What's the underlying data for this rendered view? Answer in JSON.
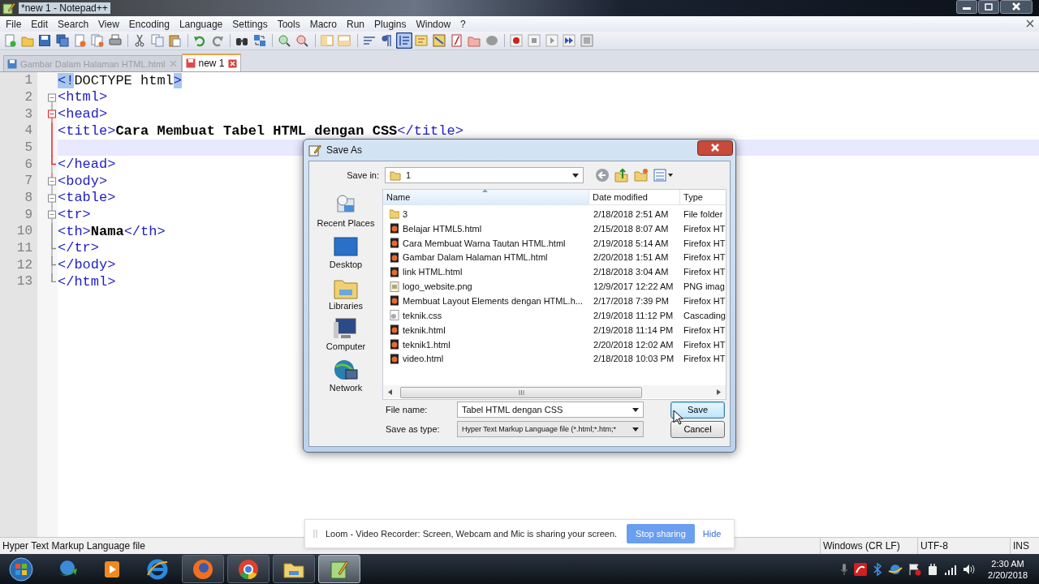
{
  "window": {
    "title": "*new 1 - Notepad++"
  },
  "menu": [
    "File",
    "Edit",
    "Search",
    "View",
    "Encoding",
    "Language",
    "Settings",
    "Tools",
    "Macro",
    "Run",
    "Plugins",
    "Window",
    "?"
  ],
  "toolbar": [
    {
      "kind": "new",
      "pressed": false
    },
    {
      "kind": "open",
      "pressed": false
    },
    {
      "kind": "save",
      "pressed": false
    },
    {
      "kind": "save-all",
      "pressed": false
    },
    {
      "kind": "close",
      "pressed": false
    },
    {
      "kind": "close-all",
      "pressed": false
    },
    {
      "kind": "print",
      "pressed": false
    },
    {
      "kind": "sep"
    },
    {
      "kind": "cut",
      "pressed": false
    },
    {
      "kind": "copy",
      "pressed": false
    },
    {
      "kind": "paste",
      "pressed": false
    },
    {
      "kind": "sep"
    },
    {
      "kind": "undo",
      "pressed": false
    },
    {
      "kind": "redo",
      "pressed": false
    },
    {
      "kind": "sep"
    },
    {
      "kind": "find",
      "pressed": false
    },
    {
      "kind": "replace",
      "pressed": false
    },
    {
      "kind": "sep"
    },
    {
      "kind": "zoom-in",
      "pressed": false
    },
    {
      "kind": "zoom-out",
      "pressed": false
    },
    {
      "kind": "sep"
    },
    {
      "kind": "sync-v",
      "pressed": false
    },
    {
      "kind": "sync-h",
      "pressed": false
    },
    {
      "kind": "sep"
    },
    {
      "kind": "wrap",
      "pressed": false
    },
    {
      "kind": "all-chars",
      "pressed": false
    },
    {
      "kind": "indent",
      "pressed": true
    },
    {
      "kind": "udl",
      "pressed": false
    },
    {
      "kind": "doc-map",
      "pressed": false
    },
    {
      "kind": "function-list",
      "pressed": false
    },
    {
      "kind": "folder-ws",
      "pressed": false
    },
    {
      "kind": "monitor",
      "pressed": false
    },
    {
      "kind": "sep"
    },
    {
      "kind": "record",
      "pressed": false
    },
    {
      "kind": "stop",
      "pressed": false
    },
    {
      "kind": "play",
      "pressed": false
    },
    {
      "kind": "play-multi",
      "pressed": false
    },
    {
      "kind": "save-macro",
      "pressed": false
    }
  ],
  "tabs": [
    {
      "label": "Gambar Dalam Halaman HTML.html",
      "selected": false,
      "modified": false
    },
    {
      "label": "new 1",
      "selected": true,
      "modified": true
    }
  ],
  "editor": {
    "lines": [
      {
        "number": "1",
        "kind": "none",
        "in_current_block": false,
        "current": false,
        "tokens": [
          {
            "kind": "match",
            "text": "<!"
          },
          {
            "kind": "plain",
            "text": "DOCTYPE html"
          },
          {
            "kind": "match",
            "text": ">"
          }
        ]
      },
      {
        "number": "2",
        "kind": "open",
        "in_current_block": false,
        "current": false,
        "tokens": [
          {
            "kind": "tag",
            "text": "<html>"
          }
        ]
      },
      {
        "number": "3",
        "kind": "open",
        "in_current_block": true,
        "current": false,
        "tokens": [
          {
            "kind": "tag",
            "text": "<head>"
          }
        ]
      },
      {
        "number": "4",
        "kind": "line",
        "in_current_block": true,
        "current": false,
        "tokens": [
          {
            "kind": "tag",
            "text": "<title>"
          },
          {
            "kind": "text",
            "text": "Cara Membuat Tabel HTML dengan CSS"
          },
          {
            "kind": "tag",
            "text": "</title>"
          }
        ]
      },
      {
        "number": "5",
        "kind": "line",
        "in_current_block": true,
        "current": true
      },
      {
        "number": "6",
        "kind": "end",
        "in_current_block": true,
        "current": false,
        "tokens": [
          {
            "kind": "tag",
            "text": "</head>"
          }
        ]
      },
      {
        "number": "7",
        "kind": "open",
        "in_current_block": false,
        "current": false,
        "tokens": [
          {
            "kind": "tag",
            "text": "<body>"
          }
        ]
      },
      {
        "number": "8",
        "kind": "open",
        "in_current_block": false,
        "current": false,
        "tokens": [
          {
            "kind": "tag",
            "text": "<table>"
          }
        ]
      },
      {
        "number": "9",
        "kind": "open",
        "in_current_block": false,
        "current": false,
        "tokens": [
          {
            "kind": "tag",
            "text": "<tr>"
          }
        ]
      },
      {
        "number": "10",
        "kind": "line",
        "in_current_block": false,
        "current": false,
        "tokens": [
          {
            "kind": "tag",
            "text": "<th>"
          },
          {
            "kind": "text",
            "text": "Nama"
          },
          {
            "kind": "tag",
            "text": "</th>"
          }
        ]
      },
      {
        "number": "11",
        "kind": "end",
        "in_current_block": false,
        "current": false,
        "tokens": [
          {
            "kind": "tag",
            "text": "</tr>"
          }
        ]
      },
      {
        "number": "12",
        "kind": "end",
        "in_current_block": false,
        "current": false,
        "tokens": [
          {
            "kind": "tag",
            "text": "</body>"
          }
        ]
      },
      {
        "number": "13",
        "kind": "end",
        "in_current_block": false,
        "current": false,
        "tokens": [
          {
            "kind": "tag",
            "text": "</html>"
          }
        ]
      }
    ]
  },
  "dialog": {
    "title": "Save As",
    "save_in_label": "Save in:",
    "save_in": "1",
    "places": [
      {
        "kind": "recent",
        "label": "Recent Places"
      },
      {
        "kind": "desktop",
        "label": "Desktop"
      },
      {
        "kind": "libraries",
        "label": "Libraries"
      },
      {
        "kind": "computer",
        "label": "Computer"
      },
      {
        "kind": "network",
        "label": "Network"
      }
    ],
    "columns": [
      {
        "label": "Name",
        "sorted": true
      },
      {
        "label": "Date modified",
        "sorted": false
      },
      {
        "label": "Type",
        "sorted": false
      }
    ],
    "files": [
      {
        "kind": "folder",
        "name": "3",
        "date": "2/18/2018 2:51 AM",
        "type": "File folder"
      },
      {
        "kind": "html",
        "name": "Belajar HTML5.html",
        "date": "2/15/2018 8:07 AM",
        "type": "Firefox HT"
      },
      {
        "kind": "html",
        "name": "Cara Membuat Warna Tautan HTML.html",
        "date": "2/19/2018 5:14 AM",
        "type": "Firefox HT"
      },
      {
        "kind": "html",
        "name": "Gambar Dalam Halaman HTML.html",
        "date": "2/20/2018 1:51 AM",
        "type": "Firefox HT"
      },
      {
        "kind": "html",
        "name": "link HTML.html",
        "date": "2/18/2018 3:04 AM",
        "type": "Firefox HT"
      },
      {
        "kind": "image",
        "name": "logo_website.png",
        "date": "12/9/2017 12:22 AM",
        "type": "PNG imag"
      },
      {
        "kind": "html",
        "name": "Membuat Layout Elements dengan HTML.h...",
        "date": "2/17/2018 7:39 PM",
        "type": "Firefox HT"
      },
      {
        "kind": "css",
        "name": "teknik.css",
        "date": "2/19/2018 11:12 PM",
        "type": "Cascading"
      },
      {
        "kind": "html",
        "name": "teknik.html",
        "date": "2/19/2018 11:14 PM",
        "type": "Firefox HT"
      },
      {
        "kind": "html",
        "name": "teknik1.html",
        "date": "2/20/2018 12:02 AM",
        "type": "Firefox HT"
      },
      {
        "kind": "html",
        "name": "video.html",
        "date": "2/18/2018 10:03 PM",
        "type": "Firefox HT"
      }
    ],
    "file_name_label": "File name:",
    "file_name": "Tabel HTML dengan CSS",
    "type_label": "Save as type:",
    "save_type": "Hyper Text Markup Language file (*.html;*.htm;*",
    "buttons": [
      {
        "label": "Save",
        "default": true
      },
      {
        "label": "Cancel",
        "default": false
      }
    ]
  },
  "status_bar": {
    "file_type": "Hyper Text Markup Language file",
    "eol": "Windows (CR LF)",
    "encoding": "UTF-8",
    "mode": "INS"
  },
  "loom_bar": {
    "message": "Loom - Video Recorder: Screen, Webcam and Mic is sharing your screen.",
    "stop": "Stop sharing",
    "hide": "Hide"
  },
  "taskbar": {
    "items": [
      {
        "kind": "start",
        "running": false,
        "selected": false
      },
      {
        "kind": "download",
        "running": false,
        "selected": false
      },
      {
        "kind": "media",
        "running": false,
        "selected": false
      },
      {
        "kind": "ie",
        "running": false,
        "selected": false
      },
      {
        "kind": "firefox",
        "running": true,
        "selected": false
      },
      {
        "kind": "chrome",
        "running": true,
        "selected": false
      },
      {
        "kind": "explorer",
        "running": true,
        "selected": false
      },
      {
        "kind": "notepad",
        "running": true,
        "selected": true
      }
    ],
    "time": "2:30 AM",
    "date": "2/20/2018"
  }
}
